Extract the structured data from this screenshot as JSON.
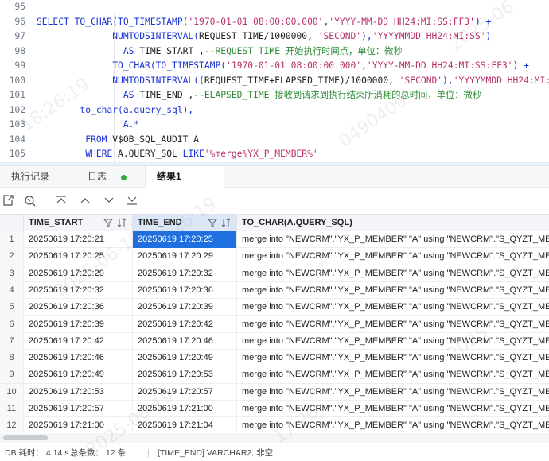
{
  "editor": {
    "lines": [
      {
        "num": "95",
        "segments": []
      },
      {
        "num": "96",
        "segments": [
          {
            "t": "SELECT TO_CHAR(TO_TIMESTAMP(",
            "c": "kw"
          },
          {
            "t": "'1970-01-01 08:00:00.000'",
            "c": "str"
          },
          {
            "t": ",",
            "c": "txt"
          },
          {
            "t": "'YYYY-MM-DD HH24:MI:SS:FF3'",
            "c": "str"
          },
          {
            "t": ") +",
            "c": "kw"
          }
        ]
      },
      {
        "num": "97",
        "segments": [
          {
            "t": "              NUMTODSINTERVAL(",
            "c": "kw"
          },
          {
            "t": "REQUEST_TIME/1000000, ",
            "c": "txt"
          },
          {
            "t": "'SECOND'",
            "c": "str"
          },
          {
            "t": "),",
            "c": "kw"
          },
          {
            "t": "'YYYYMMDD HH24:MI:SS'",
            "c": "str"
          },
          {
            "t": ")",
            "c": "kw"
          }
        ]
      },
      {
        "num": "98",
        "segments": [
          {
            "t": "                AS ",
            "c": "kw"
          },
          {
            "t": "TIME_START ,",
            "c": "txt"
          },
          {
            "t": "--REQUEST_TIME 开始执行时间点，单位：微秒",
            "c": "cmt"
          }
        ]
      },
      {
        "num": "99",
        "segments": [
          {
            "t": "              TO_CHAR(TO_TIMESTAMP(",
            "c": "kw"
          },
          {
            "t": "'1970-01-01 08:00:00.000'",
            "c": "str"
          },
          {
            "t": ",",
            "c": "txt"
          },
          {
            "t": "'YYYY-MM-DD HH24:MI:SS:FF3'",
            "c": "str"
          },
          {
            "t": ") +",
            "c": "kw"
          }
        ]
      },
      {
        "num": "100",
        "segments": [
          {
            "t": "              NUMTODSINTERVAL((",
            "c": "kw"
          },
          {
            "t": "REQUEST_TIME+ELAPSED_TIME)/1000000, ",
            "c": "txt"
          },
          {
            "t": "'SECOND'",
            "c": "str"
          },
          {
            "t": "),",
            "c": "kw"
          },
          {
            "t": "'YYYYMMDD HH24:MI:",
            "c": "str"
          }
        ]
      },
      {
        "num": "101",
        "segments": [
          {
            "t": "                AS ",
            "c": "kw"
          },
          {
            "t": "TIME_END ,",
            "c": "txt"
          },
          {
            "t": "--ELAPSED_TIME 接收到请求到执行结束所消耗的总时间，单位：微秒",
            "c": "cmt"
          }
        ]
      },
      {
        "num": "102",
        "segments": [
          {
            "t": "        to_char(a.query_sql),",
            "c": "kw"
          }
        ]
      },
      {
        "num": "103",
        "segments": [
          {
            "t": "                A.*",
            "c": "kw"
          }
        ]
      },
      {
        "num": "104",
        "segments": [
          {
            "t": "         FROM ",
            "c": "kw"
          },
          {
            "t": "V$OB_SQL_AUDIT A",
            "c": "txt"
          }
        ]
      },
      {
        "num": "105",
        "segments": [
          {
            "t": "         WHERE ",
            "c": "kw"
          },
          {
            "t": "A.QUERY_SQL ",
            "c": "txt"
          },
          {
            "t": "LIKE",
            "c": "kw"
          },
          {
            "t": "'%merge%YX_P_MEMBER%'",
            "c": "str"
          }
        ]
      },
      {
        "num": "106",
        "segments": [
          {
            "t": "          and ",
            "c": "kw"
          },
          {
            "t": "A.QUERY_SQL ",
            "c": "txt"
          },
          {
            "t": "not LIKE",
            "c": "kw"
          },
          {
            "t": "'%OB_SQL_AUDIT%'",
            "c": "str"
          },
          {
            "t": " ;",
            "c": "txt"
          }
        ]
      }
    ]
  },
  "tabs": [
    {
      "label": "执行记录",
      "active": false
    },
    {
      "label": "日志",
      "active": false,
      "dot": true
    },
    {
      "label": "结果1",
      "active": true
    }
  ],
  "toolbar": {
    "icons": [
      "export-icon",
      "refresh-icon",
      "first-page-icon",
      "prev-page-icon",
      "next-page-icon",
      "last-page-icon"
    ]
  },
  "grid": {
    "columns": [
      {
        "label": "TIME_START",
        "filter": true
      },
      {
        "label": "TIME_END",
        "filter": true,
        "selected": true
      },
      {
        "label": "TO_CHAR(A.QUERY_SQL)",
        "filter": false
      }
    ],
    "rows": [
      {
        "n": "1",
        "start": "20250619 17:20:21",
        "end": "20250619 17:20:25",
        "sql": "merge into \"NEWCRM\".\"YX_P_MEMBER\" \"A\" using \"NEWCRM\".\"S_QYZT_MEMBER_"
      },
      {
        "n": "2",
        "start": "20250619 17:20:25",
        "end": "20250619 17:20:29",
        "sql": "merge into \"NEWCRM\".\"YX_P_MEMBER\" \"A\" using \"NEWCRM\".\"S_QYZT_MEMBER_"
      },
      {
        "n": "3",
        "start": "20250619 17:20:29",
        "end": "20250619 17:20:32",
        "sql": "merge into \"NEWCRM\".\"YX_P_MEMBER\" \"A\" using \"NEWCRM\".\"S_QYZT_MEMBER_"
      },
      {
        "n": "4",
        "start": "20250619 17:20:32",
        "end": "20250619 17:20:36",
        "sql": "merge into \"NEWCRM\".\"YX_P_MEMBER\" \"A\" using \"NEWCRM\".\"S_QYZT_MEMBER_"
      },
      {
        "n": "5",
        "start": "20250619 17:20:36",
        "end": "20250619 17:20:39",
        "sql": "merge into \"NEWCRM\".\"YX_P_MEMBER\" \"A\" using \"NEWCRM\".\"S_QYZT_MEMBER_"
      },
      {
        "n": "6",
        "start": "20250619 17:20:39",
        "end": "20250619 17:20:42",
        "sql": "merge into \"NEWCRM\".\"YX_P_MEMBER\" \"A\" using \"NEWCRM\".\"S_QYZT_MEMBER_"
      },
      {
        "n": "7",
        "start": "20250619 17:20:42",
        "end": "20250619 17:20:46",
        "sql": "merge into \"NEWCRM\".\"YX_P_MEMBER\" \"A\" using \"NEWCRM\".\"S_QYZT_MEMBER_"
      },
      {
        "n": "8",
        "start": "20250619 17:20:46",
        "end": "20250619 17:20:49",
        "sql": "merge into \"NEWCRM\".\"YX_P_MEMBER\" \"A\" using \"NEWCRM\".\"S_QYZT_MEMBER_"
      },
      {
        "n": "9",
        "start": "20250619 17:20:49",
        "end": "20250619 17:20:53",
        "sql": "merge into \"NEWCRM\".\"YX_P_MEMBER\" \"A\" using \"NEWCRM\".\"S_QYZT_MEMBER_"
      },
      {
        "n": "10",
        "start": "20250619 17:20:53",
        "end": "20250619 17:20:57",
        "sql": "merge into \"NEWCRM\".\"YX_P_MEMBER\" \"A\" using \"NEWCRM\".\"S_QYZT_MEMBER_"
      },
      {
        "n": "11",
        "start": "20250619 17:20:57",
        "end": "20250619 17:21:00",
        "sql": "merge into \"NEWCRM\".\"YX_P_MEMBER\" \"A\" using \"NEWCRM\".\"S_QYZT_MEMBER_"
      },
      {
        "n": "12",
        "start": "20250619 17:21:00",
        "end": "20250619 17:21:04",
        "sql": "merge into \"NEWCRM\".\"YX_P_MEMBER\" \"A\" using \"NEWCRM\".\"S_QYZT_MEMBER_"
      }
    ],
    "selected_row": 0,
    "selected_col": 1
  },
  "status": {
    "elapsed": "DB 耗时： 4.14 s",
    "count": "总条数： 12 条",
    "column_info": "[TIME_END] VARCHAR2, 非空"
  },
  "colors": {
    "keyword": "#1a33d6",
    "string": "#b8326c",
    "comment": "#2e8a37",
    "selection": "#1e6fe0",
    "log_dot": "#2dab3b"
  }
}
